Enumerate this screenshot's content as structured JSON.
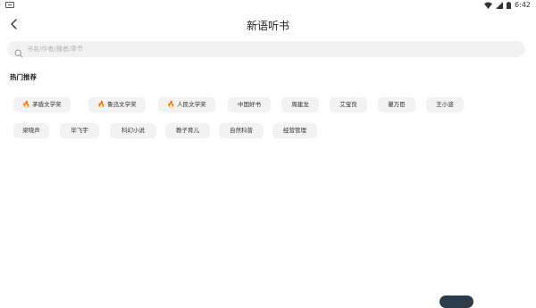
{
  "status_bar": {
    "time": "6:42",
    "icons": [
      "sd-card-icon",
      "wifi-icon",
      "cellular-icon",
      "battery-icon"
    ]
  },
  "header": {
    "title": "新语听书",
    "back_icon": "chevron-left-icon"
  },
  "search": {
    "placeholder": "书名/作者/播者/章节",
    "value": ""
  },
  "hot": {
    "title": "热门推荐",
    "row1": [
      {
        "label": "茅盾文学奖",
        "hot": true
      },
      {
        "label": "鲁迅文学奖",
        "hot": true
      },
      {
        "label": "人民文学奖",
        "hot": true
      },
      {
        "label": "中国好书",
        "hot": false
      },
      {
        "label": "周建龙",
        "hot": false
      },
      {
        "label": "艾宝良",
        "hot": false
      },
      {
        "label": "瞿万臣",
        "hot": false
      },
      {
        "label": "王小波",
        "hot": false
      }
    ],
    "row2": [
      {
        "label": "梁晓声",
        "hot": false
      },
      {
        "label": "毕飞宇",
        "hot": false
      },
      {
        "label": "科幻小说",
        "hot": false
      },
      {
        "label": "教子育儿",
        "hot": false
      },
      {
        "label": "自然科普",
        "hot": false
      },
      {
        "label": "经营管理",
        "hot": false
      }
    ]
  },
  "colors": {
    "chip_bg": "#f2f2f2",
    "fire": "#e84a2f",
    "search_bg": "#f2f2f2"
  }
}
